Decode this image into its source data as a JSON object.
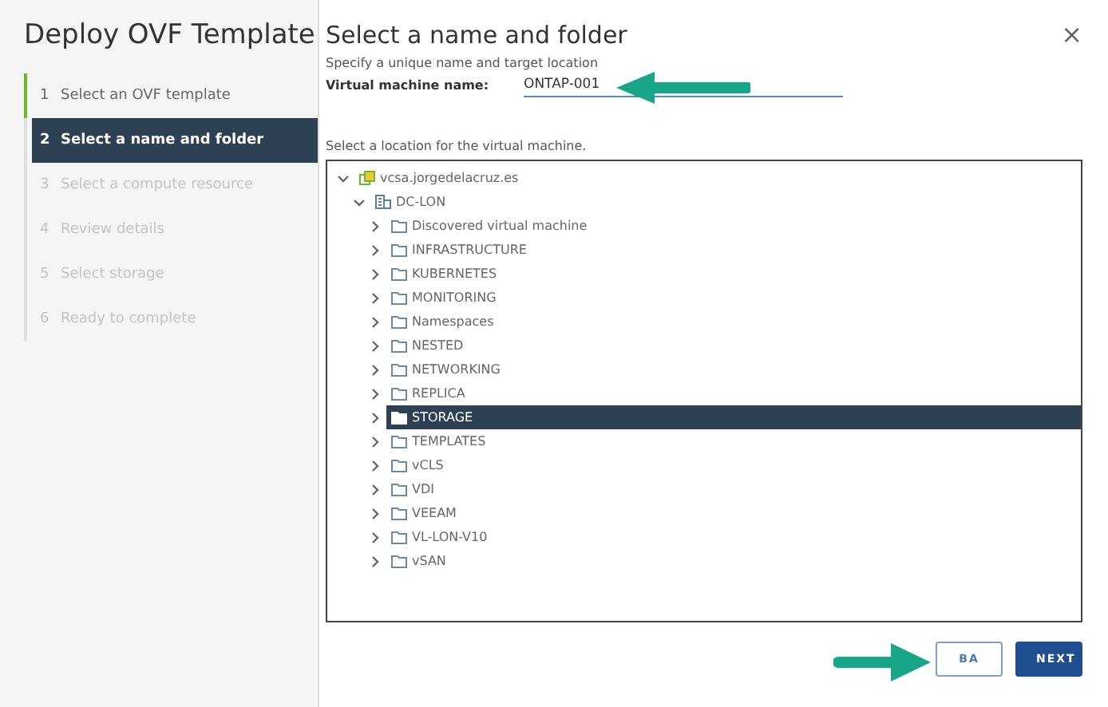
{
  "sidebar": {
    "title": "Deploy OVF Template",
    "steps": [
      {
        "number": "1",
        "label": "Select an OVF template",
        "selected": false,
        "done": true
      },
      {
        "number": "2",
        "label": "Select a name and folder",
        "selected": true,
        "done": false
      },
      {
        "number": "3",
        "label": "Select a compute resource",
        "selected": false,
        "done": false
      },
      {
        "number": "4",
        "label": "Review details",
        "selected": false,
        "done": false
      },
      {
        "number": "5",
        "label": "Select storage",
        "selected": false,
        "done": false
      },
      {
        "number": "6",
        "label": "Ready to complete",
        "selected": false,
        "done": false
      }
    ]
  },
  "main": {
    "title": "Select a name and folder",
    "close": "×",
    "subtitle": "Specify a unique name and target location",
    "name_field": {
      "label": "Virtual machine name:",
      "value": "ONTAP-001"
    },
    "location_label": "Select a location for the virtual machine.",
    "tree": [
      {
        "label": "vcsa.jorgedelacruz.es",
        "kind": "vcenter",
        "expanded": true,
        "selected": false,
        "children": [
          {
            "label": "DC-LON",
            "kind": "datacenter",
            "expanded": true,
            "selected": false,
            "children": [
              {
                "label": "Discovered virtual machine",
                "kind": "folder",
                "expanded": false,
                "selected": false
              },
              {
                "label": "INFRASTRUCTURE",
                "kind": "folder",
                "expanded": false,
                "selected": false
              },
              {
                "label": "KUBERNETES",
                "kind": "folder",
                "expanded": false,
                "selected": false
              },
              {
                "label": "MONITORING",
                "kind": "folder",
                "expanded": false,
                "selected": false
              },
              {
                "label": "Namespaces",
                "kind": "folder",
                "expanded": false,
                "selected": false
              },
              {
                "label": "NESTED",
                "kind": "folder",
                "expanded": false,
                "selected": false
              },
              {
                "label": "NETWORKING",
                "kind": "folder",
                "expanded": false,
                "selected": false
              },
              {
                "label": "REPLICA",
                "kind": "folder",
                "expanded": false,
                "selected": false
              },
              {
                "label": "STORAGE",
                "kind": "folder",
                "expanded": false,
                "selected": true
              },
              {
                "label": "TEMPLATES",
                "kind": "folder",
                "expanded": false,
                "selected": false
              },
              {
                "label": "vCLS",
                "kind": "folder",
                "expanded": false,
                "selected": false
              },
              {
                "label": "VDI",
                "kind": "folder",
                "expanded": false,
                "selected": false
              },
              {
                "label": "VEEAM",
                "kind": "folder",
                "expanded": false,
                "selected": false
              },
              {
                "label": "VL-LON-V10",
                "kind": "folder",
                "expanded": false,
                "selected": false
              },
              {
                "label": "vSAN",
                "kind": "folder",
                "expanded": false,
                "selected": false
              }
            ]
          }
        ]
      }
    ],
    "buttons": [
      {
        "label": "BA",
        "kind": "outline"
      },
      {
        "label": "NEXT",
        "kind": "primary"
      }
    ]
  }
}
